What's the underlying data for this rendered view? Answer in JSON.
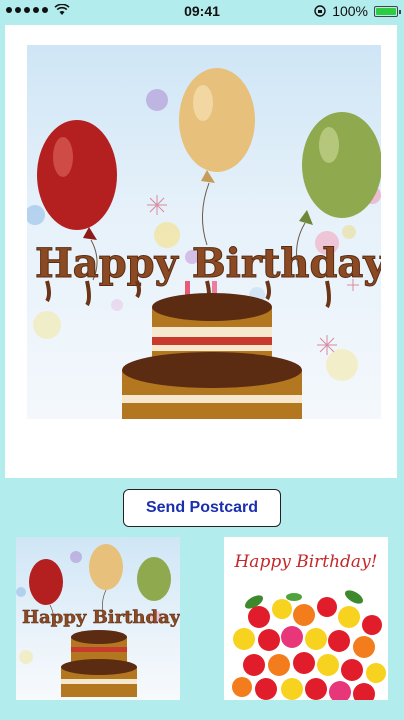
{
  "status_bar": {
    "time": "09:41",
    "battery_percent": "100%",
    "signal_icon": "signal-dots-icon",
    "wifi_icon": "wifi-icon",
    "lock_icon": "rotation-lock-icon",
    "battery_icon": "battery-icon"
  },
  "main_card": {
    "image_text": "Happy Birthday!"
  },
  "send_button": {
    "label": "Send Postcard",
    "color": "#1a2fb0"
  },
  "thumbnails": {
    "cake_text": "Happy Birthday!",
    "roses_text": "Happy Birthday!"
  },
  "colors": {
    "background": "#b3ecec",
    "card": "#ffffff"
  }
}
